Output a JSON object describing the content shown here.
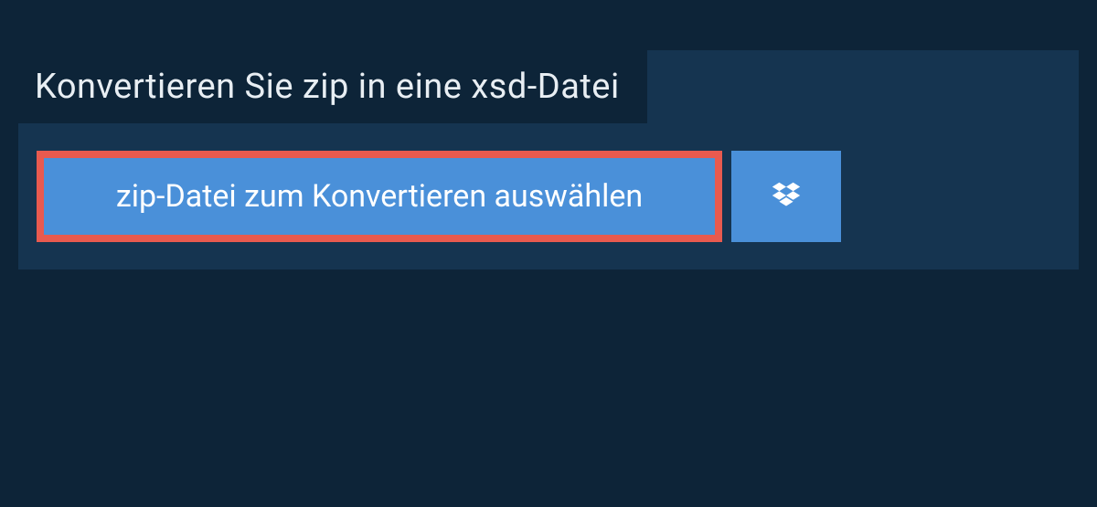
{
  "heading": "Konvertieren Sie zip in eine xsd-Datei",
  "choose_button_label": "zip-Datei zum Konvertieren auswählen"
}
